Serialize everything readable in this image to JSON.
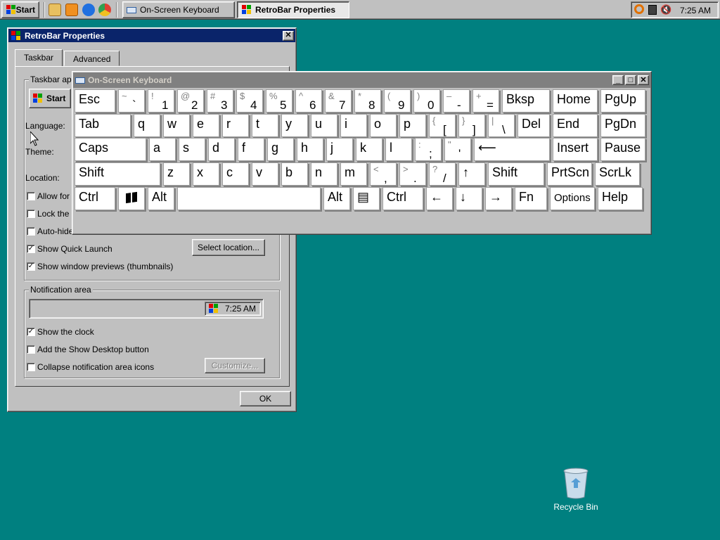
{
  "taskbar": {
    "start_label": "Start",
    "windows": [
      {
        "label": "On-Screen Keyboard"
      },
      {
        "label": "RetroBar Properties"
      }
    ],
    "clock": "7:25 AM"
  },
  "props_window": {
    "title": "RetroBar Properties",
    "close_glyph": "✕",
    "tabs": [
      "Taskbar",
      "Advanced"
    ],
    "appearance_group_label": "Taskbar app",
    "preview_start": "Start",
    "language_label": "Language:",
    "theme_label": "Theme:",
    "location_label": "Location:",
    "checkboxes": [
      {
        "label": "Allow for",
        "checked": false
      },
      {
        "label": "Lock the",
        "checked": false
      },
      {
        "label": "Auto-hide the taskbar",
        "checked": false
      },
      {
        "label": "Show Quick Launch",
        "checked": true
      },
      {
        "label": "Show window previews (thumbnails)",
        "checked": true
      }
    ],
    "select_location_button": "Select location...",
    "notification_group_label": "Notification area",
    "tray_preview_clock": "7:25 AM",
    "notif_checkboxes": [
      {
        "label": "Show the clock",
        "checked": true
      },
      {
        "label": "Add the Show Desktop button",
        "checked": false
      },
      {
        "label": "Collapse notification area icons",
        "checked": false
      }
    ],
    "customize_button": "Customize...",
    "ok_button": "OK"
  },
  "osk": {
    "title": "On-Screen Keyboard",
    "rows": [
      [
        {
          "main": "Esc"
        },
        {
          "shift": "~",
          "base": "`"
        },
        {
          "shift": "!",
          "base": "1"
        },
        {
          "shift": "@",
          "base": "2"
        },
        {
          "shift": "#",
          "base": "3"
        },
        {
          "shift": "$",
          "base": "4"
        },
        {
          "shift": "%",
          "base": "5"
        },
        {
          "shift": "^",
          "base": "6"
        },
        {
          "shift": "&",
          "base": "7"
        },
        {
          "shift": "*",
          "base": "8"
        },
        {
          "shift": "(",
          "base": "9"
        },
        {
          "shift": ")",
          "base": "0"
        },
        {
          "shift": "–",
          "base": "-"
        },
        {
          "shift": "+",
          "base": "="
        },
        {
          "main": "Bksp"
        },
        {
          "main": "Home"
        },
        {
          "main": "PgUp"
        }
      ],
      [
        {
          "main": "Tab"
        },
        {
          "main": "q"
        },
        {
          "main": "w"
        },
        {
          "main": "e"
        },
        {
          "main": "r"
        },
        {
          "main": "t"
        },
        {
          "main": "y"
        },
        {
          "main": "u"
        },
        {
          "main": "i"
        },
        {
          "main": "o"
        },
        {
          "main": "p"
        },
        {
          "shift": "{",
          "base": "["
        },
        {
          "shift": "}",
          "base": "]"
        },
        {
          "shift": "|",
          "base": "\\"
        },
        {
          "main": "Del"
        },
        {
          "main": "End"
        },
        {
          "main": "PgDn"
        }
      ],
      [
        {
          "main": "Caps"
        },
        {
          "main": "a"
        },
        {
          "main": "s"
        },
        {
          "main": "d"
        },
        {
          "main": "f"
        },
        {
          "main": "g"
        },
        {
          "main": "h"
        },
        {
          "main": "j"
        },
        {
          "main": "k"
        },
        {
          "main": "l"
        },
        {
          "shift": ":",
          "base": ";"
        },
        {
          "shift": "\"",
          "base": "'"
        },
        {
          "main": "⟵"
        },
        {
          "main": "Insert"
        },
        {
          "main": "Pause"
        }
      ],
      [
        {
          "main": "Shift"
        },
        {
          "main": "z"
        },
        {
          "main": "x"
        },
        {
          "main": "c"
        },
        {
          "main": "v"
        },
        {
          "main": "b"
        },
        {
          "main": "n"
        },
        {
          "main": "m"
        },
        {
          "shift": "<",
          "base": ","
        },
        {
          "shift": ">",
          "base": "."
        },
        {
          "shift": "?",
          "base": "/"
        },
        {
          "main": "↑"
        },
        {
          "main": "Shift"
        },
        {
          "main": "PrtScn"
        },
        {
          "main": "ScrLk"
        }
      ],
      [
        {
          "main": "Ctrl"
        },
        {
          "main": "",
          "icon": "windows-logo-icon"
        },
        {
          "main": "Alt"
        },
        {
          "main": ""
        },
        {
          "main": "Alt"
        },
        {
          "main": "▤",
          "icon": "menu-key-icon"
        },
        {
          "main": "Ctrl"
        },
        {
          "main": "←"
        },
        {
          "main": "↓"
        },
        {
          "main": "→"
        },
        {
          "main": "Fn"
        },
        {
          "main": "Options"
        },
        {
          "main": "Help"
        }
      ]
    ]
  },
  "desktop": {
    "recycle_bin_label": "Recycle Bin"
  },
  "colors": {
    "desktop": "#008080",
    "active_title": "#0a246a",
    "inactive_title": "#808080",
    "face": "#c0c0c0"
  }
}
